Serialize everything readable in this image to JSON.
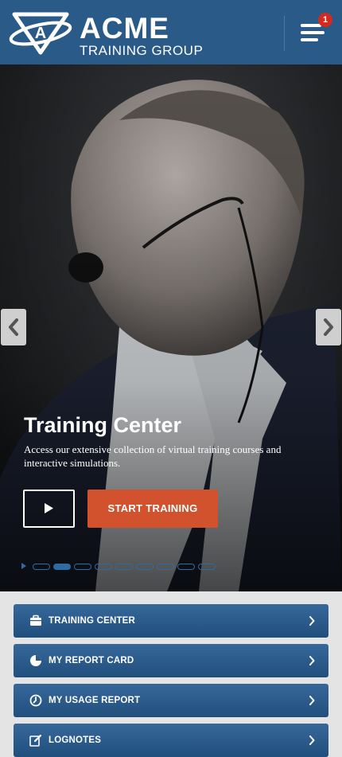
{
  "header": {
    "brand_name": "ACME",
    "brand_sub": "TRAINING GROUP",
    "logo_letter": "A",
    "notification_count": "1"
  },
  "hero": {
    "title": "Training Center",
    "description": "Access our extensive collection of virtual training courses and interactive simulations.",
    "start_button": "START TRAINING",
    "slide_count": 9,
    "active_slide": 2
  },
  "menu": {
    "items": [
      {
        "label": "TRAINING CENTER",
        "icon": "briefcase-icon"
      },
      {
        "label": "MY REPORT CARD",
        "icon": "pie-chart-icon"
      },
      {
        "label": "MY USAGE REPORT",
        "icon": "clock-icon"
      },
      {
        "label": "LOGNOTES",
        "icon": "edit-icon"
      }
    ]
  },
  "colors": {
    "header": "#2a5a88",
    "accent": "#d3522e",
    "menu_button": "#2b5b8a",
    "badge": "#d12b1f"
  }
}
